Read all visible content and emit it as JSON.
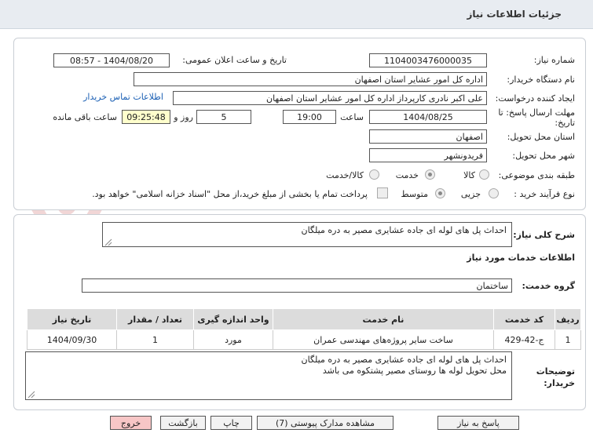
{
  "header": {
    "title": "جزئیات اطلاعات نیاز"
  },
  "form": {
    "need_number_label": "شماره نیاز:",
    "need_number": "1104003476000035",
    "announce_label": "تاریخ و ساعت اعلان عمومی:",
    "announce_value": "1404/08/20 - 08:57",
    "buyer_org_label": "نام دستگاه خریدار:",
    "buyer_org": "اداره کل امور عشایر استان اصفهان",
    "creator_label": "ایجاد کننده درخواست:",
    "creator": "علی اکبر نادری کارپرداز اداره کل امور عشایر استان اصفهان",
    "contact_link": "اطلاعات تماس خریدار",
    "deadline_label": "مهلت ارسال پاسخ: تا تاریخ:",
    "deadline_date": "1404/08/25",
    "time_label": "ساعت",
    "deadline_time": "19:00",
    "days": "5",
    "days_label": "روز و",
    "remaining_time": "09:25:48",
    "remaining_label": "ساعت باقی مانده",
    "province_label": "استان محل تحویل:",
    "province": "اصفهان",
    "city_label": "شهر محل تحویل:",
    "city": "فریدونشهر",
    "category_label": "طبقه بندی موضوعی:",
    "category_options": [
      "کالا",
      "خدمت",
      "کالا/خدمت"
    ],
    "category_selected": "خدمت",
    "process_label": "نوع فرآیند خرید :",
    "process_options": [
      "جزیی",
      "متوسط"
    ],
    "process_selected": "متوسط",
    "payment_note": "پرداخت تمام یا بخشی از مبلغ خرید،از محل \"اسناد خزانه اسلامی\" خواهد بود."
  },
  "details": {
    "summary_label": "شرح کلی نیاز:",
    "summary": "احداث پل های لوله ای جاده عشایری  مصیر به دره میلگان",
    "services_title": "اطلاعات خدمات مورد نیاز",
    "service_group_label": "گروه خدمت:",
    "service_group": "ساختمان",
    "table": {
      "headers": [
        "ردیف",
        "کد خدمت",
        "نام خدمت",
        "واحد اندازه گیری",
        "تعداد / مقدار",
        "تاریخ نیاز"
      ],
      "rows": [
        [
          "1",
          "ج-42-429",
          "ساخت سایر پروژه‌های مهندسی عمران",
          "مورد",
          "1",
          "1404/09/30"
        ]
      ]
    },
    "buyer_notes_label": "توضیحات خریدار:",
    "buyer_notes": "احداث پل های لوله ای جاده عشایری مصیر به دره میلگان\nمحل تحویل لوله ها روستای مصیر پشتکوه می باشد"
  },
  "watermark": {
    "text": "AriaTender.net"
  },
  "buttons": {
    "reply": "پاسخ به نیاز",
    "attachments": "مشاهده مدارک پیوستی (7)",
    "print": "چاپ",
    "back": "بازگشت",
    "exit": "خروج"
  },
  "colors": {
    "remaining_bg": "#ffffcc",
    "link": "#1a5fb4",
    "exit_bg": "#f7c6c6",
    "watermark": "#f1d6d6"
  }
}
